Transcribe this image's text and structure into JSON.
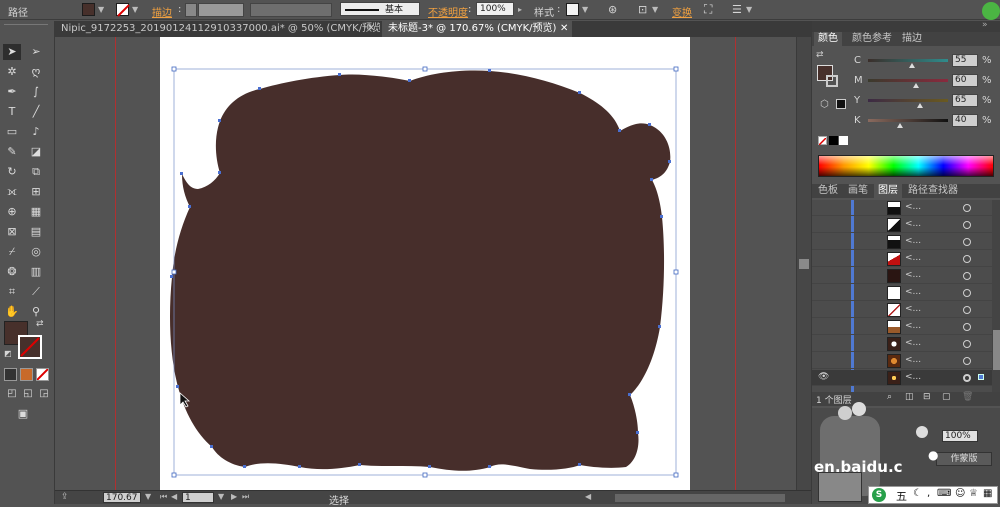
{
  "control_bar": {
    "object_type": "路径",
    "stroke_label": "描边",
    "stroke_style": "基本",
    "opacity_label": "不透明度",
    "opacity_value": "100%",
    "style_label": "样式",
    "transform_label": "变换",
    "fill_color": "#47302b"
  },
  "tabs": [
    {
      "label": "Nipic_9172253_20190124112910337000.ai* @ 50% (CMYK/预览)"
    },
    {
      "label": "未标题-3* @ 170.67% (CMYK/预览)"
    }
  ],
  "color_panel": {
    "tabs": [
      "颜色",
      "颜色参考",
      "描边"
    ],
    "channels": [
      {
        "name": "C",
        "value": "55",
        "fraction": 0.55
      },
      {
        "name": "M",
        "value": "60",
        "fraction": 0.6
      },
      {
        "name": "Y",
        "value": "65",
        "fraction": 0.65
      },
      {
        "name": "K",
        "value": "40",
        "fraction": 0.4
      }
    ]
  },
  "layers_panel": {
    "tabs": [
      "色板",
      "画笔",
      "图层",
      "路径查找器"
    ],
    "item_text": "<...",
    "layer_count": "1 个图层"
  },
  "lower_panel": {
    "zoom_value": "100%",
    "button_label": "作蒙版"
  },
  "status_bar": {
    "zoom": "170.67",
    "page": "1",
    "tool": "选择"
  },
  "watermark": "en.baidu.c",
  "ime_label": "五",
  "art": {
    "fill": "#472e2b"
  }
}
